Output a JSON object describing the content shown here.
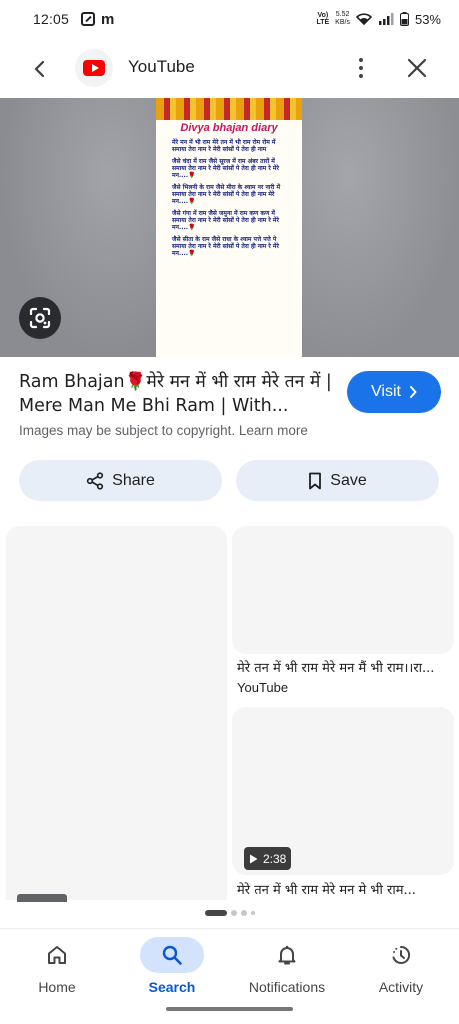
{
  "status_bar": {
    "time": "12:05",
    "network_top": "Vo)",
    "network_bottom": "LTE",
    "speed_value": "5.52",
    "speed_unit": "KB/s",
    "battery": "53%"
  },
  "header": {
    "title": "YouTube"
  },
  "image": {
    "doc_title": "Divya bhajan diary",
    "paragraphs": [
      "मेरे मन में भी राम मेरे तन में भी राम रोम रोम में समाया तेरा नाम रे मेरी सांसों पे तेरा ही नाम",
      "जैसे चंदा में राम जैसे सूरज में राम अंबर तारों में समाया तेरा नाम रे मेरी सांसों पे तेरा ही नाम रे मेरे मन....",
      "जैसे भिलनी के राम जैसे मीरा के श्याम नर नारी में समाया तेरा नाम रे मेरी सांसों पे तेरा ही नाम मेरे मन....",
      "जैसे गंगा में राम जैसे जमुना में राम कण कण में समाया तेरा नाम रे मेरी सांसों पे तेरा ही नाम रे मेरे मन....",
      "जैसे सीता के राम जैसे राधा के श्याम पत्ते पत्ते पे समाया तेरा नाम रे मेरी सांसों पे तेरा ही नाम रे मेरे मन...."
    ],
    "rose": "🌹"
  },
  "result": {
    "title": "Ram Bhajan🌹मेरे मन में भी राम मेरे तन में | Mere Man Me Bhi Ram | With...",
    "visit_label": "Visit",
    "copyright_text": "Images may be subject to copyright.",
    "learn_more": "Learn more"
  },
  "actions": {
    "share_label": "Share",
    "save_label": "Save"
  },
  "related": {
    "card1_caption": "मेरे तन में भी राम मेरे मन मैं भी राम।।रा...",
    "card1_source": "YouTube",
    "card2_duration": "2:38",
    "card2_caption": "मेरे तन में भी राम मेरे मन मे भी राम..."
  },
  "bottom_nav": {
    "home": "Home",
    "search": "Search",
    "notifications": "Notifications",
    "activity": "Activity"
  },
  "colors": {
    "accent": "#1a73e8",
    "nav_active": "#0b57d0",
    "nav_active_bg": "#d3e3fd",
    "youtube_red": "#ff0000"
  }
}
